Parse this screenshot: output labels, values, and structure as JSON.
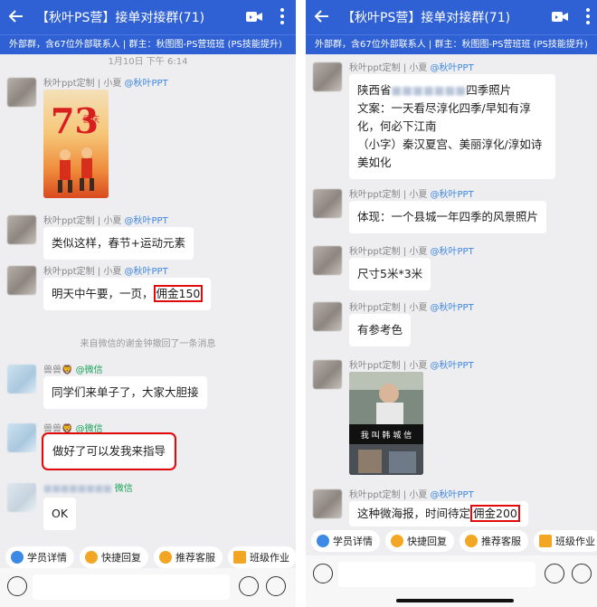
{
  "left": {
    "title": "【秋叶PS营】接单对接群(71)",
    "subtitle": "外部群，含67位外部联系人 | 群主：秋图图-PS营班班 (PS技能提升)",
    "timestamp": "1月10日  下午 6:14",
    "messages": [
      {
        "sender": "秋叶ppt定制 | 小夏",
        "org": "@秋叶PPT",
        "type": "image",
        "poster_text": "国庆",
        "poster_num": "73"
      },
      {
        "sender": "秋叶ppt定制 | 小夏",
        "org": "@秋叶PPT",
        "text": "类似这样，春节+运动元素"
      },
      {
        "sender": "秋叶ppt定制 | 小夏",
        "org": "@秋叶PPT",
        "text_pre": "明天中午要，一页，",
        "text_hl": "佣金150"
      },
      {
        "system": "来自微信的谢金钟撤回了一条消息"
      },
      {
        "sender": "兽兽",
        "emoji": "🦁",
        "org": "@微信",
        "text": "同学们来单子了，大家大胆接"
      },
      {
        "sender": "兽兽",
        "emoji": "🦁",
        "org": "@微信",
        "text": "做好了可以发我来指导"
      },
      {
        "sender": "",
        "org": "微信",
        "text": "OK"
      }
    ]
  },
  "right": {
    "title": "【秋叶PS营】接单对接群(71)",
    "subtitle": "外部群，含67位外部联系人 | 群主：秋图图-PS营班班 (PS技能提升)",
    "messages": [
      {
        "sender": "秋叶ppt定制 | 小夏",
        "org": "@秋叶PPT",
        "line1_pre": "陕西省",
        "line1_post": "四季照片",
        "lines": [
          "文案：一天看尽淳化四季/早知有淳",
          "化，何必下江南",
          "（小字）秦汉夏宫、美丽淳化/淳如诗",
          "美如化"
        ]
      },
      {
        "sender": "秋叶ppt定制 | 小夏",
        "org": "@秋叶PPT",
        "text": "体现：一个县城一年四季的风景照片"
      },
      {
        "sender": "秋叶ppt定制 | 小夏",
        "org": "@秋叶PPT",
        "text": "尺寸5米*3米"
      },
      {
        "sender": "秋叶ppt定制 | 小夏",
        "org": "@秋叶PPT",
        "text": "有参考色"
      },
      {
        "sender": "秋叶ppt定制 | 小夏",
        "org": "@秋叶PPT",
        "type": "image",
        "poster_text": "我 叫 韩 城 信"
      },
      {
        "sender": "秋叶ppt定制 | 小夏",
        "org": "@秋叶PPT",
        "text_pre": "这种微海报，时间待定",
        "text_hl": "佣金200"
      }
    ]
  },
  "quick_actions": [
    "学员详情",
    "快捷回复",
    "推荐客服",
    "班级作业"
  ],
  "colors": {
    "accent": "#2f61d5",
    "highlight": "#e20a0a",
    "bubble": "#ffffff",
    "background": "#eeeef0",
    "org": "#3c86e0",
    "wechat": "#19a35b"
  }
}
